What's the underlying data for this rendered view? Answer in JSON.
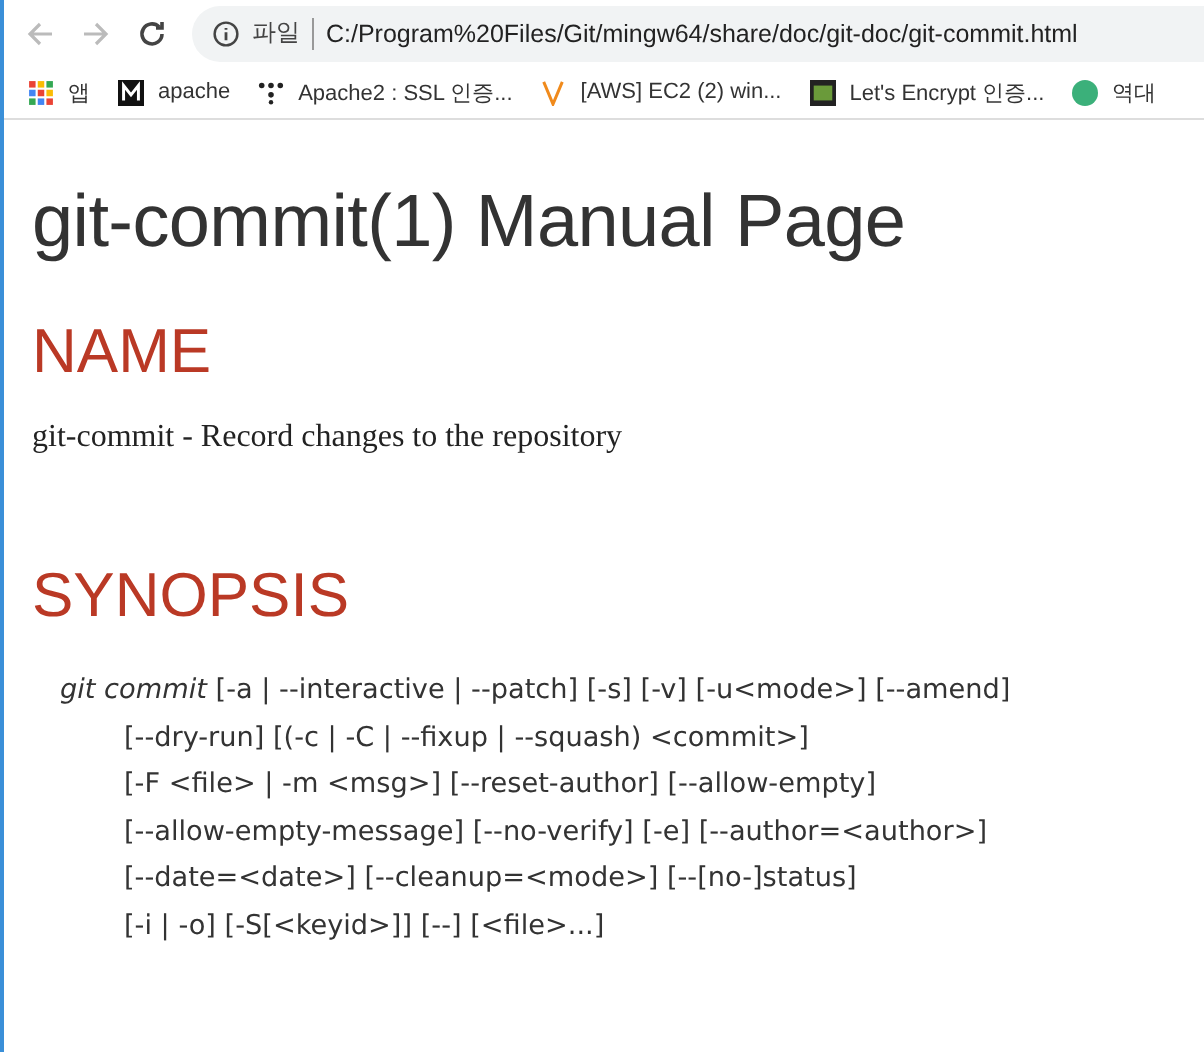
{
  "browser": {
    "url_label": "파일",
    "url": "C:/Program%20Files/Git/mingw64/share/doc/git-doc/git-commit.html",
    "bookmarks": [
      {
        "kind": "apps",
        "label": "앱"
      },
      {
        "kind": "m",
        "label": "apache"
      },
      {
        "kind": "dots",
        "label": "Apache2 : SSL 인증..."
      },
      {
        "kind": "v",
        "label": "[AWS] EC2 (2) win..."
      },
      {
        "kind": "board",
        "label": "Let's Encrypt 인증..."
      },
      {
        "kind": "circle",
        "label": "역대"
      }
    ]
  },
  "page": {
    "title": "git-commit(1) Manual Page",
    "sections": [
      {
        "heading": "NAME",
        "kind": "text",
        "text": "git-commit - Record changes to the repository"
      },
      {
        "heading": "SYNOPSIS",
        "kind": "synopsis",
        "lines": [
          "*git commit* [-a | --interactive | --patch] [-s] [-v] [-u<mode>] [--amend]",
          "[--dry-run] [(-c | -C | --fixup | --squash) <commit>]",
          "[-F <file> | -m <msg>] [--reset-author] [--allow-empty]",
          "[--allow-empty-message] [--no-verify] [-e] [--author=<author>]",
          "[--date=<date>] [--cleanup=<mode>] [--[no-]status]",
          "[-i | -o] [-S[<keyid>]] [--] [<file>...]"
        ]
      }
    ]
  }
}
